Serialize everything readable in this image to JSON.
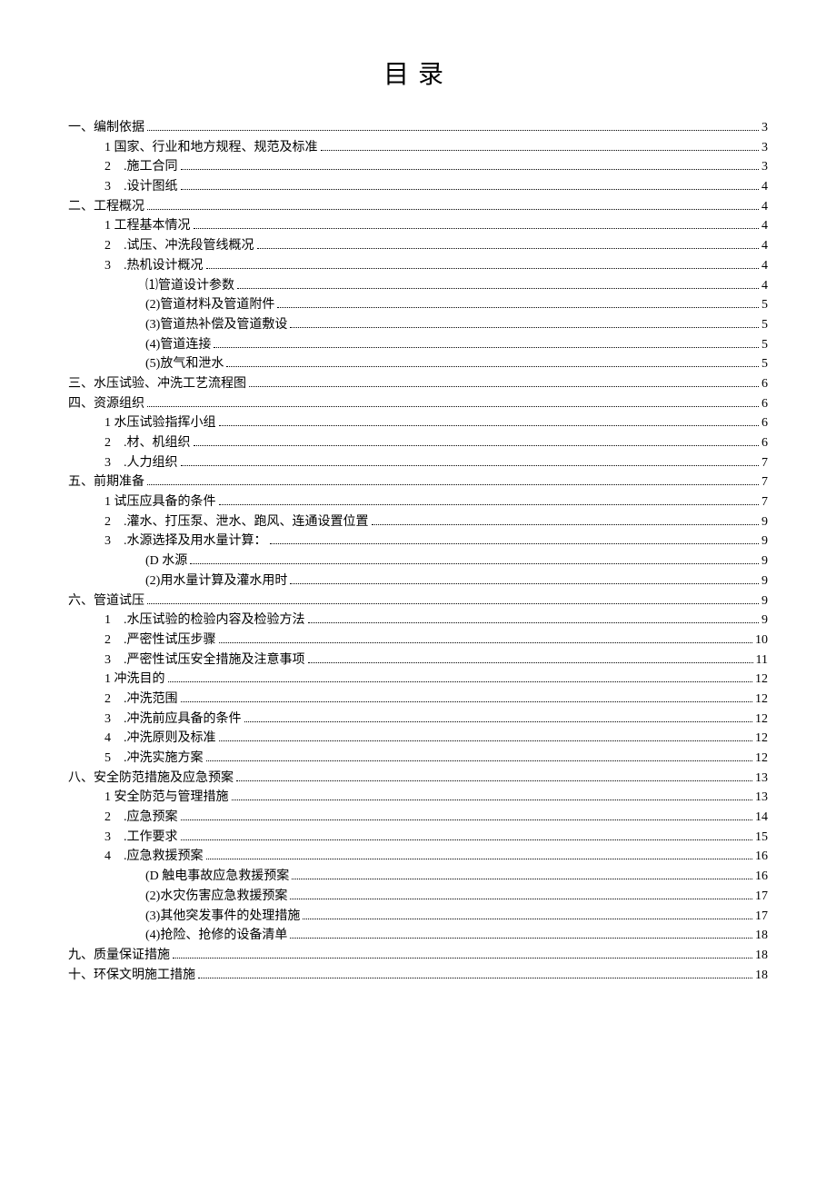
{
  "title": "目录",
  "entries": [
    {
      "level": 1,
      "label": "一、编制依据",
      "page": "3"
    },
    {
      "level": 2,
      "label": "1 国家、行业和地方规程、规范及标准",
      "page": "3"
    },
    {
      "level": 2,
      "label": "2　.施工合同",
      "page": "3"
    },
    {
      "level": 2,
      "label": "3　.设计图纸",
      "page": "4"
    },
    {
      "level": 1,
      "label": "二、工程概况",
      "page": "4"
    },
    {
      "level": 2,
      "label": "1 工程基本情况",
      "page": "4"
    },
    {
      "level": 2,
      "label": "2　.试压、冲洗段管线概况",
      "page": "4"
    },
    {
      "level": 2,
      "label": "3　.热机设计概况",
      "page": "4"
    },
    {
      "level": 3,
      "label": "⑴管道设计参数",
      "page": "4"
    },
    {
      "level": 3,
      "label": "(2)管道材料及管道附件",
      "page": "5"
    },
    {
      "level": 3,
      "label": "(3)管道热补偿及管道敷设",
      "page": "5"
    },
    {
      "level": 3,
      "label": "(4)管道连接",
      "page": "5"
    },
    {
      "level": 3,
      "label": "(5)放气和泄水",
      "page": "5"
    },
    {
      "level": 1,
      "label": "三、水压试验、冲洗工艺流程图",
      "page": "6"
    },
    {
      "level": 1,
      "label": "四、资源组织",
      "page": "6"
    },
    {
      "level": 2,
      "label": "1 水压试验指挥小组",
      "page": "6"
    },
    {
      "level": 2,
      "label": "2　.材、机组织",
      "page": "6"
    },
    {
      "level": 2,
      "label": "3　.人力组织",
      "page": "7"
    },
    {
      "level": 1,
      "label": "五、前期准备",
      "page": "7"
    },
    {
      "level": 2,
      "label": "1 试压应具备的条件",
      "page": "7"
    },
    {
      "level": 2,
      "label": "2　.灌水、打压泵、泄水、跑风、连通设置位置",
      "page": "9"
    },
    {
      "level": 2,
      "label": "3　.水源选择及用水量计算：",
      "page": "9"
    },
    {
      "level": 3,
      "label": "(D 水源",
      "page": "9"
    },
    {
      "level": 3,
      "label": "(2)用水量计算及灌水用时",
      "page": "9"
    },
    {
      "level": 1,
      "label": "六、管道试压",
      "page": "9"
    },
    {
      "level": 2,
      "label": "1　.水压试验的检验内容及检验方法",
      "page": "9"
    },
    {
      "level": 2,
      "label": "2　.严密性试压步骤",
      "page": "10"
    },
    {
      "level": 2,
      "label": "3　.严密性试压安全措施及注意事项",
      "page": "11"
    },
    {
      "level": 2,
      "label": "1 冲洗目的",
      "page": "12"
    },
    {
      "level": 2,
      "label": "2　.冲洗范围",
      "page": "12"
    },
    {
      "level": 2,
      "label": "3　.冲洗前应具备的条件",
      "page": "12"
    },
    {
      "level": 2,
      "label": "4　.冲洗原则及标准",
      "page": "12"
    },
    {
      "level": 2,
      "label": "5　.冲洗实施方案",
      "page": "12"
    },
    {
      "level": 1,
      "label": "八、安全防范措施及应急预案",
      "page": "13"
    },
    {
      "level": 2,
      "label": "1 安全防范与管理措施",
      "page": "13"
    },
    {
      "level": 2,
      "label": "2　.应急预案",
      "page": "14"
    },
    {
      "level": 2,
      "label": "3　.工作要求",
      "page": "15"
    },
    {
      "level": 2,
      "label": "4　.应急救援预案",
      "page": "16"
    },
    {
      "level": 3,
      "label": "(D 触电事故应急救援预案",
      "page": "16"
    },
    {
      "level": 3,
      "label": "(2)水灾伤害应急救援预案",
      "page": "17"
    },
    {
      "level": 3,
      "label": "(3)其他突发事件的处理措施",
      "page": "17"
    },
    {
      "level": 3,
      "label": "(4)抢险、抢修的设备清单",
      "page": "18"
    },
    {
      "level": 1,
      "label": "九、质量保证措施",
      "page": "18"
    },
    {
      "level": 1,
      "label": "十、环保文明施工措施",
      "page": "18"
    }
  ]
}
